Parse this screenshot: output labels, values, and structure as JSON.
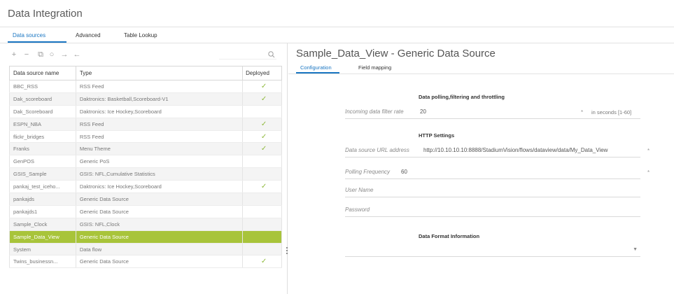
{
  "app": {
    "title": "Data Integration"
  },
  "main_tabs": [
    {
      "label": "Data sources",
      "active": true
    },
    {
      "label": "Advanced",
      "active": false
    },
    {
      "label": "Table Lookup",
      "active": false
    }
  ],
  "toolbar": {
    "add": "+",
    "remove": "−",
    "copy": "⧉",
    "refresh": "○",
    "import": "→",
    "export": "←",
    "search_placeholder": ""
  },
  "table": {
    "headers": [
      "Data source name",
      "Type",
      "Deployed"
    ],
    "check_glyph": "✓",
    "rows": [
      {
        "name": "BBC_RSS",
        "type": "RSS Feed",
        "deployed": true
      },
      {
        "name": "Dak_scoreboard",
        "type": "Daktronics: Basketball,Scoreboard-V1",
        "deployed": true
      },
      {
        "name": "Dak_Scoreboard",
        "type": "Daktronics: Ice Hockey,Scoreboard",
        "deployed": false
      },
      {
        "name": "ESPN_NBA",
        "type": "RSS Feed",
        "deployed": true
      },
      {
        "name": "flickr_bridges",
        "type": "RSS Feed",
        "deployed": true
      },
      {
        "name": "Franks",
        "type": "Menu Theme",
        "deployed": true
      },
      {
        "name": "GenPOS",
        "type": "Generic PoS",
        "deployed": false
      },
      {
        "name": "GSIS_Sample",
        "type": "GSIS: NFL,Cumulative Statistics",
        "deployed": false
      },
      {
        "name": "pankaj_test_iceho...",
        "type": "Daktronics: Ice Hockey,Scoreboard",
        "deployed": true
      },
      {
        "name": "pankajds",
        "type": "Generic Data Source",
        "deployed": false
      },
      {
        "name": "pankajds1",
        "type": "Generic Data Source",
        "deployed": false
      },
      {
        "name": "Sample_Clock",
        "type": "GSIS: NFL,Clock",
        "deployed": false
      },
      {
        "name": "Sample_Data_View",
        "type": "Generic Data Source",
        "deployed": false,
        "selected": true
      },
      {
        "name": "System",
        "type": "Data flow",
        "deployed": false
      },
      {
        "name": "Twins_businessn...",
        "type": "Generic Data Source",
        "deployed": true
      }
    ]
  },
  "detail": {
    "title": "Sample_Data_View - Generic Data Source",
    "tabs": [
      {
        "label": "Configuration",
        "active": true
      },
      {
        "label": "Field mapping",
        "active": false
      }
    ],
    "polling_section": {
      "heading": "Data polling,filtering and throttling",
      "filter_rate_label": "Incoming data filter rate",
      "filter_rate_value": "20",
      "filter_rate_required": "*",
      "filter_rate_hint": "in seconds [1-60]"
    },
    "http_section": {
      "heading": "HTTP Settings",
      "url_label": "Data source URL address",
      "url_value": "http://10.10.10.10:8888/StadiumVision/flows/dataview/data/My_Data_View",
      "url_required": "*",
      "polling_label": "Polling Frequency",
      "polling_value": "60",
      "polling_required": "*",
      "user_label": "User Name",
      "password_label": "Password"
    },
    "format_section": {
      "heading": "Data Format Information",
      "caret": "▼"
    }
  },
  "colors": {
    "accent": "#1a76c2",
    "selected_row": "#a8c43a",
    "check": "#8fb93c"
  }
}
